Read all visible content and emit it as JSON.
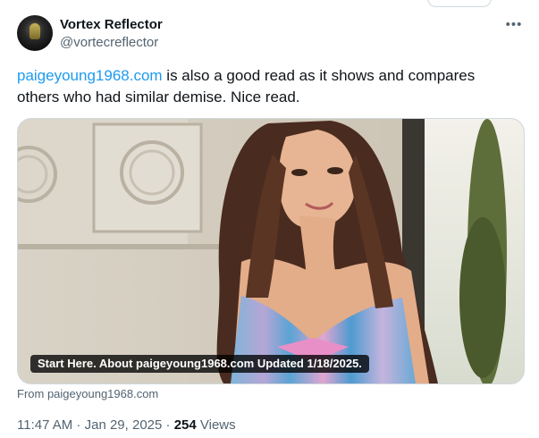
{
  "author": {
    "display_name": "Vortex Reflector",
    "handle": "@vortecreflector"
  },
  "tweet": {
    "link_text": "paigeyoung1968.com",
    "text_after_link": " is also a good read as it shows and compares others who had similar demise. Nice read."
  },
  "card": {
    "caption": "Start Here. About paigeyoung1968.com Updated 1/18/2025.",
    "source": "From paigeyoung1968.com"
  },
  "meta": {
    "time": "11:47 AM",
    "separator1": " · ",
    "date": "Jan 29, 2025",
    "separator2": " · ",
    "views_count": "254",
    "views_label": " Views"
  },
  "icons": {
    "more": "more-icon"
  }
}
